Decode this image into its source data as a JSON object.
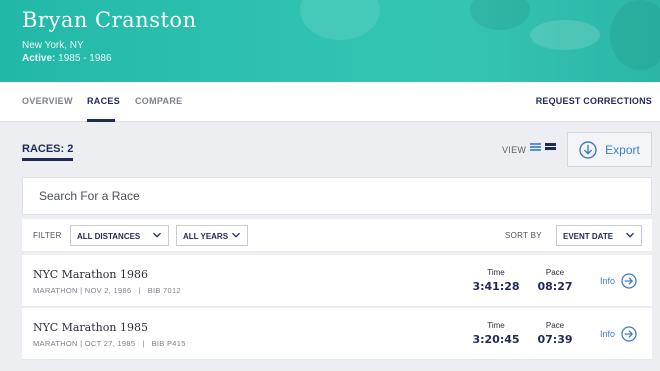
{
  "athlete": {
    "name": "Bryan Cranston",
    "location": "New York, NY",
    "active_label": "Active:",
    "active_range": "1985 - 1986"
  },
  "tabs": [
    {
      "label": "OVERVIEW",
      "active": false
    },
    {
      "label": "RACES",
      "active": true
    },
    {
      "label": "COMPARE",
      "active": false
    }
  ],
  "request_corrections": "REQUEST CORRECTIONS",
  "races_header": {
    "count_label": "RACES: 2",
    "view_label": "VIEW",
    "export_label": "Export"
  },
  "search": {
    "placeholder": "Search For a Race",
    "value": ""
  },
  "filters": {
    "filter_label": "FILTER",
    "distance": "ALL DISTANCES",
    "years": "ALL YEARS",
    "sort_label": "SORT BY",
    "sort_value": "EVENT DATE"
  },
  "races": [
    {
      "title": "NYC Marathon 1986",
      "meta": "MARATHON | NOV 2, 1986",
      "bib": "BIB 7012",
      "time_label": "Time",
      "time": "3:41:28",
      "pace_label": "Pace",
      "pace": "08:27",
      "info_label": "Info"
    },
    {
      "title": "NYC Marathon 1985",
      "meta": "MARATHON | OCT 27, 1985",
      "bib": "BIB P415",
      "time_label": "Time",
      "time": "3:20:45",
      "pace_label": "Pace",
      "pace": "07:39",
      "info_label": "Info"
    }
  ],
  "colors": {
    "hero": "#2fc2b0",
    "navy": "#1f2a55",
    "link_blue": "#3e7ec9",
    "page_bg": "#eceef1"
  }
}
